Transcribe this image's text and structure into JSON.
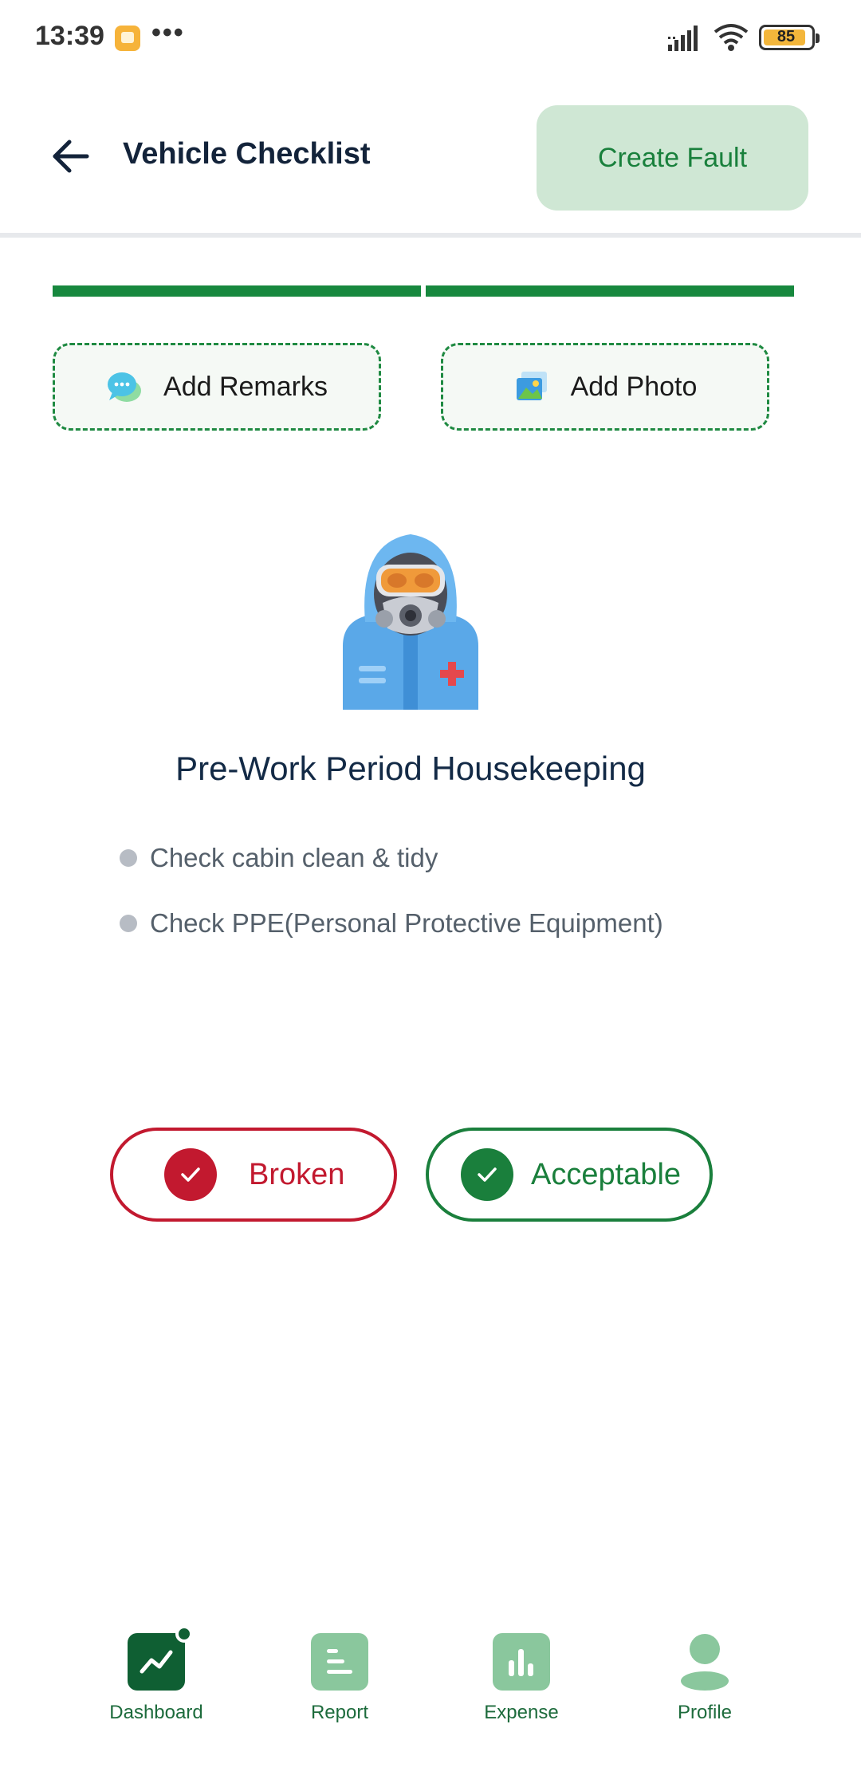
{
  "status_bar": {
    "time": "13:39",
    "dots": "•••",
    "battery": "85",
    "icons": [
      "app-notification-icon",
      "signal-icon",
      "wifi-icon",
      "battery-icon"
    ]
  },
  "header": {
    "title": "Vehicle Checklist",
    "create_fault_label": "Create Fault",
    "back_icon": "arrow-left-icon"
  },
  "progress": {
    "segments_completed": 2,
    "segments_total": 2
  },
  "actions": {
    "add_remarks_label": "Add Remarks",
    "add_photo_label": "Add Photo"
  },
  "checklist_item": {
    "title": "Pre-Work Period Housekeeping",
    "checks": [
      "Check cabin clean & tidy",
      "Check PPE(Personal Protective Equipment)"
    ]
  },
  "result": {
    "broken_label": "Broken",
    "acceptable_label": "Acceptable"
  },
  "bottom_nav": {
    "items": [
      {
        "label": "Dashboard",
        "icon": "dashboard-chart-icon",
        "active": true
      },
      {
        "label": "Report",
        "icon": "report-list-icon",
        "active": false
      },
      {
        "label": "Expense",
        "icon": "expense-bar-icon",
        "active": false
      },
      {
        "label": "Profile",
        "icon": "profile-person-icon",
        "active": false
      }
    ]
  },
  "colors": {
    "primary": "#17883e",
    "primary_light": "#cfe7d4",
    "danger": "#c2192f",
    "title": "#13233a"
  }
}
